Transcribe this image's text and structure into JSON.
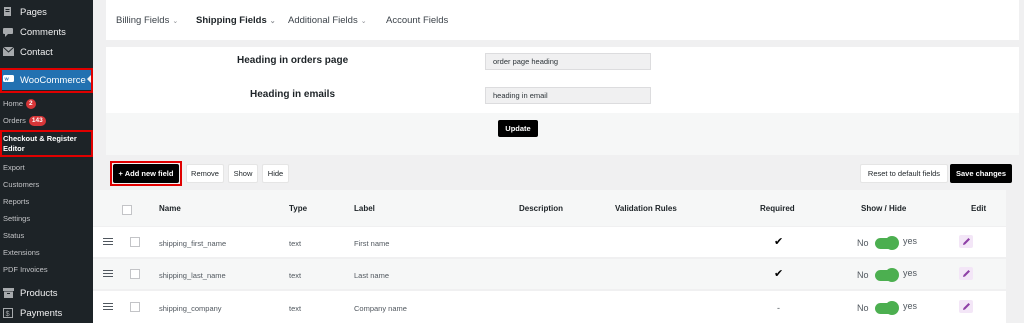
{
  "sidebar": {
    "main_items": [
      {
        "label": "Pages"
      },
      {
        "label": "Comments"
      },
      {
        "label": "Contact"
      },
      {
        "label": "WooCommerce"
      },
      {
        "label": "Products"
      },
      {
        "label": "Payments"
      }
    ],
    "woocommerce_submenu": [
      {
        "label": "Home",
        "badge": "2"
      },
      {
        "label": "Orders",
        "badge": "143"
      },
      {
        "label": "Checkout & Register Editor"
      },
      {
        "label": "Export"
      },
      {
        "label": "Customers"
      },
      {
        "label": "Reports"
      },
      {
        "label": "Settings"
      },
      {
        "label": "Status"
      },
      {
        "label": "Extensions"
      },
      {
        "label": "PDF Invoices"
      }
    ]
  },
  "tabs": [
    {
      "label": "Billing Fields",
      "has_dropdown": true
    },
    {
      "label": "Shipping Fields",
      "has_dropdown": true
    },
    {
      "label": "Additional Fields",
      "has_dropdown": true
    },
    {
      "label": "Account Fields",
      "has_dropdown": false
    }
  ],
  "settings": {
    "orders_heading_label": "Heading in orders page",
    "orders_heading_value": "order page heading",
    "emails_heading_label": "Heading in emails",
    "emails_heading_value": "heading in email",
    "update_label": "Update"
  },
  "toolbar": {
    "add_label": "+ Add new field",
    "remove_label": "Remove",
    "show_label": "Show",
    "hide_label": "Hide",
    "reset_label": "Reset to default fields",
    "save_label": "Save changes"
  },
  "table": {
    "headers": [
      "Name",
      "Type",
      "Label",
      "Description",
      "Validation Rules",
      "Required",
      "Show / Hide",
      "Edit"
    ],
    "rows": [
      {
        "name": "shipping_first_name",
        "type": "text",
        "label": "First name",
        "required": "✔",
        "toggle_off": "No",
        "toggle_on": "yes"
      },
      {
        "name": "shipping_last_name",
        "type": "text",
        "label": "Last name",
        "required": "✔",
        "toggle_off": "No",
        "toggle_on": "yes"
      },
      {
        "name": "shipping_company",
        "type": "text",
        "label": "Company name",
        "required": "-",
        "toggle_off": "No",
        "toggle_on": "yes"
      }
    ]
  },
  "colors": {
    "sidebar_bg": "#1d2327",
    "active_menu": "#2271b1",
    "highlight_box": "#e00000",
    "toggle_green": "#4caf50",
    "badge_red": "#d63638"
  }
}
